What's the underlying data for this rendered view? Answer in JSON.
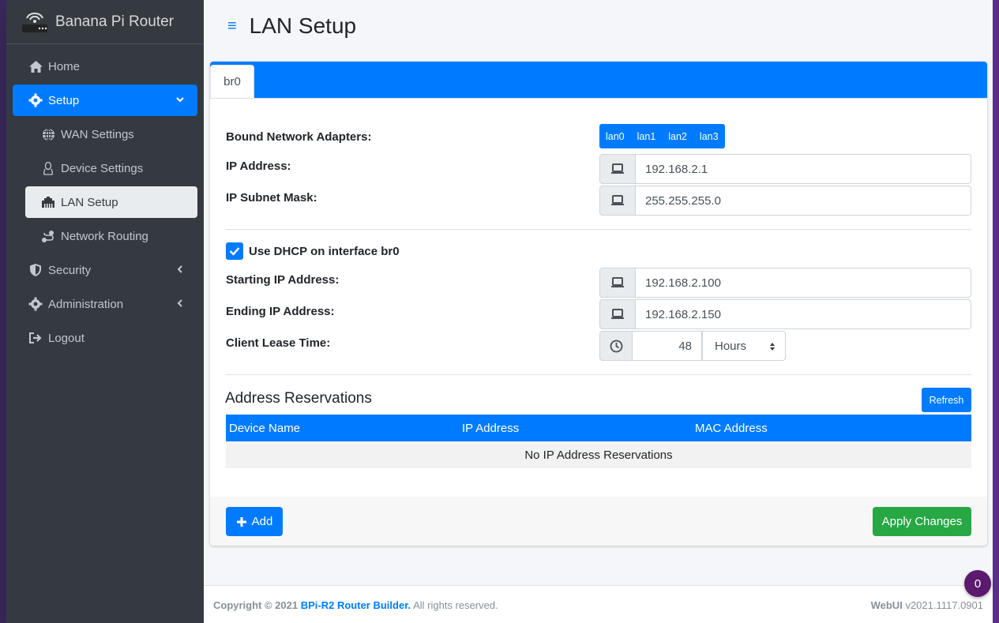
{
  "brand": {
    "name": "Banana Pi Router"
  },
  "sidebar": {
    "items": [
      {
        "label": "Home",
        "icon": "home-icon"
      },
      {
        "label": "Setup",
        "icon": "gear-icon"
      },
      {
        "label": "WAN Settings",
        "icon": "globe-icon"
      },
      {
        "label": "Device Settings",
        "icon": "linux-icon"
      },
      {
        "label": "LAN Setup",
        "icon": "ethernet-icon"
      },
      {
        "label": "Network Routing",
        "icon": "route-icon"
      },
      {
        "label": "Security",
        "icon": "shield-icon"
      },
      {
        "label": "Administration",
        "icon": "gear-icon"
      },
      {
        "label": "Logout",
        "icon": "sign-out-icon"
      }
    ]
  },
  "header": {
    "title": "LAN Setup",
    "menu_icon": "≡"
  },
  "tabs": [
    {
      "label": "br0"
    }
  ],
  "form": {
    "bound_label": "Bound Network Adapters:",
    "adapters": [
      "lan0",
      "lan1",
      "lan2",
      "lan3"
    ],
    "ip_label": "IP Address:",
    "ip_value": "192.168.2.1",
    "mask_label": "IP Subnet Mask:",
    "mask_value": "255.255.255.0",
    "dhcp_label": "Use DHCP on interface br0",
    "dhcp_checked": true,
    "start_label": "Starting IP Address:",
    "start_value": "192.168.2.100",
    "end_label": "Ending IP Address:",
    "end_value": "192.168.2.150",
    "lease_label": "Client Lease Time:",
    "lease_value": "48",
    "lease_unit": "Hours"
  },
  "reservations": {
    "title": "Address Reservations",
    "refresh_label": "Refresh",
    "columns": [
      "Device Name",
      "IP Address",
      "MAC Address"
    ],
    "empty_text": "No IP Address Reservations"
  },
  "actions": {
    "add_label": "Add",
    "apply_label": "Apply Changes"
  },
  "footer": {
    "copyright_prefix": "Copyright © 2021",
    "copyright_link": "BPi-R2 Router Builder.",
    "rights": "All rights reserved.",
    "webui_label": "WebUI",
    "version": "v2021.1117.0901"
  },
  "badge": {
    "count": "0"
  },
  "colors": {
    "accent": "#007bff",
    "success": "#28a745",
    "sidebar": "#343a40"
  }
}
